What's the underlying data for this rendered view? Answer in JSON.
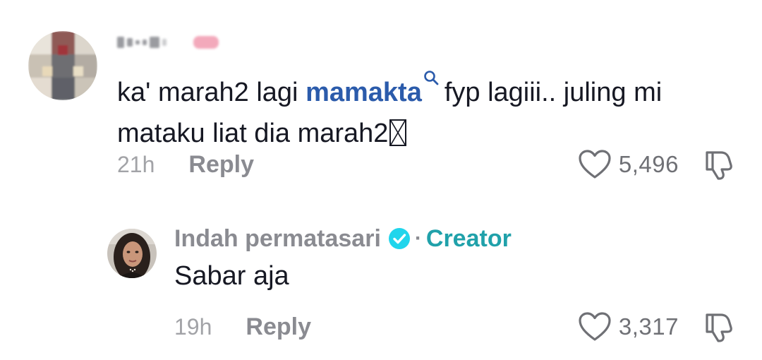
{
  "comments": [
    {
      "username": "",
      "text_before_mention": "ka' marah2 lagi ",
      "mention": "mamakta",
      "text_after_mention": "fyp lagiii.. juling mi mataku liat dia marah2",
      "timestamp": "21h",
      "reply_label": "Reply",
      "like_count": "5,496"
    },
    {
      "username": "Indah permatasari",
      "verified": true,
      "separator": "·",
      "creator_label": "Creator",
      "text": "Sabar aja",
      "timestamp": "19h",
      "reply_label": "Reply",
      "like_count": "3,317"
    }
  ],
  "colors": {
    "mention": "#2b5bab",
    "creator": "#20a1aa",
    "verified": "#20d5ec",
    "muted": "#8a8b91"
  },
  "icons": {
    "like": "heart-outline-icon",
    "dislike": "thumbs-down-outline-icon",
    "verified": "verified-check-icon",
    "mention": "search-icon"
  }
}
